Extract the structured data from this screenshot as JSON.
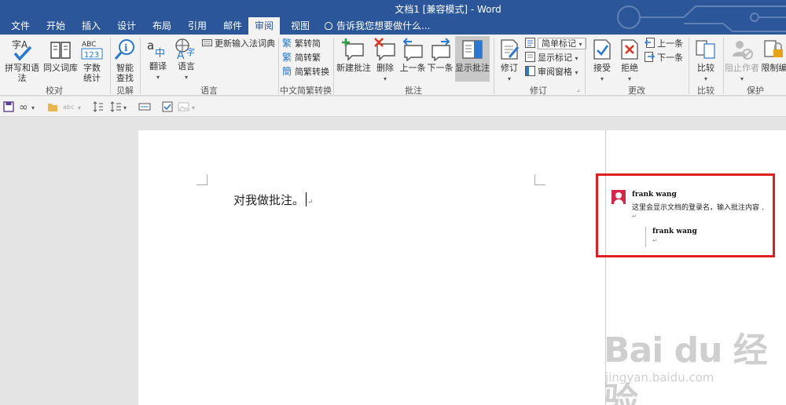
{
  "window": {
    "title": "文档1 [兼容模式] - Word"
  },
  "tabs": [
    "文件",
    "开始",
    "插入",
    "设计",
    "布局",
    "引用",
    "邮件",
    "审阅",
    "视图"
  ],
  "active_tab": "审阅",
  "tell_me": "告诉我您想要做什么...",
  "ribbon": {
    "groups": {
      "proofing": "校对",
      "insights": "见解",
      "language": "语言",
      "chinese_conversion": "中文简繁转换",
      "comments": "批注",
      "tracking": "修订",
      "changes": "更改",
      "compare": "比较",
      "protect": "保护"
    },
    "proofing": {
      "spelling": "拼写和语法",
      "thesaurus": "同义词库",
      "word_count_l1": "字数",
      "word_count_l2": "统计"
    },
    "insights": {
      "smart_lookup_l1": "智能",
      "smart_lookup_l2": "查找"
    },
    "language": {
      "translate": "翻译",
      "language": "语言",
      "update_ime": "更新输入法词典"
    },
    "chinese": {
      "to_traditional": "繁转简",
      "to_simplified": "简转繁",
      "convert": "简繁转换"
    },
    "comments": {
      "new": "新建批注",
      "delete": "删除",
      "previous": "上一条",
      "next": "下一条",
      "show": "显示批注"
    },
    "tracking": {
      "track_changes": "修订",
      "markup_select": "简单标记",
      "show_markup": "显示标记",
      "reviewing_pane": "审阅窗格"
    },
    "changes": {
      "accept": "接受",
      "reject": "拒绝",
      "previous": "上一条",
      "next": "下一条"
    },
    "compare": {
      "compare": "比较"
    },
    "protect": {
      "block_authors": "阻止作者",
      "restrict_editing": "限制编"
    }
  },
  "document": {
    "text": "对我做批注。",
    "para_mark": "↵"
  },
  "comment": {
    "author": "frank wang",
    "text": "这里会显示文档的登录名，输入批注内容 .",
    "reply_author": "frank wang",
    "mark": "↵"
  },
  "watermark": {
    "main": "Bai du 经验",
    "sub": "jingyan.baidu.com"
  },
  "colors": {
    "brand": "#2b579a",
    "highlight": "#e02020",
    "avatar": "#d9254a"
  }
}
